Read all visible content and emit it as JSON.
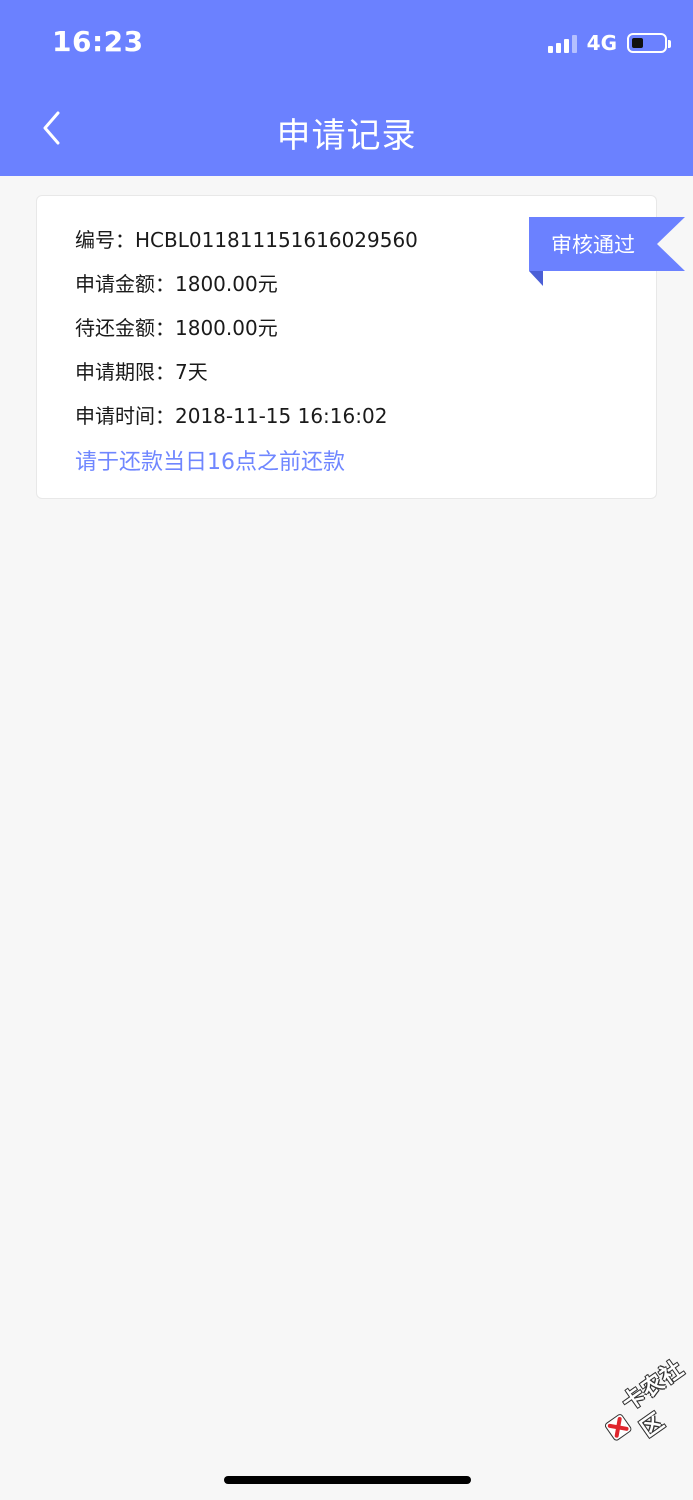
{
  "status_bar": {
    "time": "16:23",
    "network": "4G",
    "battery_level": 0.35
  },
  "nav": {
    "title": "申请记录"
  },
  "record": {
    "number_label": "编号：",
    "number_value": "HCBL011811151616029560",
    "amount_label": "申请金额：",
    "amount_value": "1800.00元",
    "repay_label": "待还金额：",
    "repay_value": "1800.00元",
    "term_label": "申请期限：",
    "term_value": "7天",
    "time_label": "申请时间：",
    "time_value": "2018-11-15 16:16:02",
    "notice": "请于还款当日16点之前还款",
    "status_badge": "审核通过"
  },
  "watermark": {
    "text": "卡农社区"
  },
  "colors": {
    "brand": "#6b81ff",
    "notice_text": "#6f86ff",
    "background": "#f7f7f7"
  }
}
